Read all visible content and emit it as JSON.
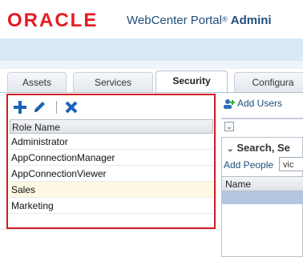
{
  "header": {
    "logo": "ORACLE",
    "product": "WebCenter Portal",
    "registered": "®",
    "section": "Admini"
  },
  "tabs": [
    {
      "label": "Assets",
      "active": false
    },
    {
      "label": "Services",
      "active": false
    },
    {
      "label": "Security",
      "active": true
    },
    {
      "label": "Configura",
      "active": false
    }
  ],
  "toolbar": {
    "add_icon": "plus-icon",
    "edit_icon": "pencil-icon",
    "delete_icon": "x-icon"
  },
  "roles_table": {
    "column_header": "Role Name",
    "rows": [
      "Administrator",
      "AppConnectionManager",
      "AppConnectionViewer",
      "Sales",
      "Marketing"
    ],
    "selected_row": "Sales"
  },
  "right": {
    "add_users_label": "Add Users",
    "search_title": "Search, Se",
    "add_people_label": "Add People",
    "add_people_value": "vic",
    "name_header": "Name"
  },
  "colors": {
    "brand_red": "#e51b24",
    "highlight_border": "#d41c24",
    "toolbar_blue": "#1b63b8"
  }
}
